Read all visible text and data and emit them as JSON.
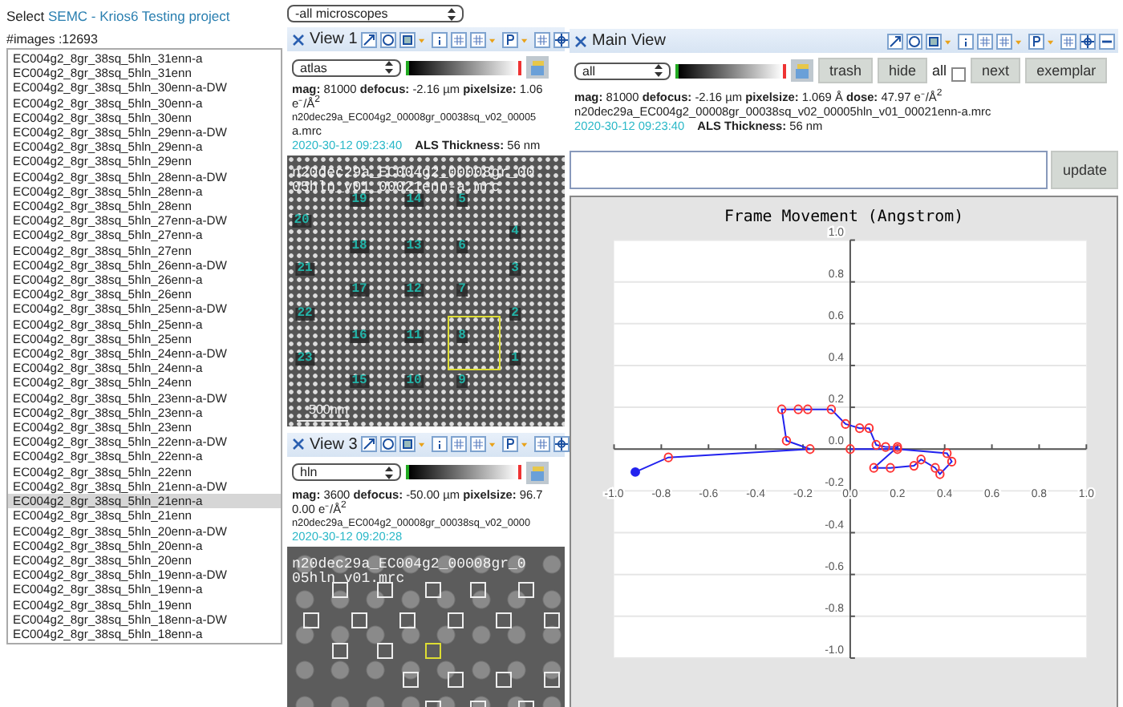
{
  "project": {
    "prefix": "Select",
    "link": "SEMC - Krios6 Testing project"
  },
  "image_count": "#images :12693",
  "image_list": [
    {
      "name": "EC004g2_8gr_38sq_5hln_31enn-a",
      "selected": false
    },
    {
      "name": "EC004g2_8gr_38sq_5hln_31enn",
      "selected": false
    },
    {
      "name": "EC004g2_8gr_38sq_5hln_30enn-a-DW",
      "selected": false
    },
    {
      "name": "EC004g2_8gr_38sq_5hln_30enn-a",
      "selected": false
    },
    {
      "name": "EC004g2_8gr_38sq_5hln_30enn",
      "selected": false
    },
    {
      "name": "EC004g2_8gr_38sq_5hln_29enn-a-DW",
      "selected": false
    },
    {
      "name": "EC004g2_8gr_38sq_5hln_29enn-a",
      "selected": false
    },
    {
      "name": "EC004g2_8gr_38sq_5hln_29enn",
      "selected": false
    },
    {
      "name": "EC004g2_8gr_38sq_5hln_28enn-a-DW",
      "selected": false
    },
    {
      "name": "EC004g2_8gr_38sq_5hln_28enn-a",
      "selected": false
    },
    {
      "name": "EC004g2_8gr_38sq_5hln_28enn",
      "selected": false
    },
    {
      "name": "EC004g2_8gr_38sq_5hln_27enn-a-DW",
      "selected": false
    },
    {
      "name": "EC004g2_8gr_38sq_5hln_27enn-a",
      "selected": false
    },
    {
      "name": "EC004g2_8gr_38sq_5hln_27enn",
      "selected": false
    },
    {
      "name": "EC004g2_8gr_38sq_5hln_26enn-a-DW",
      "selected": false
    },
    {
      "name": "EC004g2_8gr_38sq_5hln_26enn-a",
      "selected": false
    },
    {
      "name": "EC004g2_8gr_38sq_5hln_26enn",
      "selected": false
    },
    {
      "name": "EC004g2_8gr_38sq_5hln_25enn-a-DW",
      "selected": false
    },
    {
      "name": "EC004g2_8gr_38sq_5hln_25enn-a",
      "selected": false
    },
    {
      "name": "EC004g2_8gr_38sq_5hln_25enn",
      "selected": false
    },
    {
      "name": "EC004g2_8gr_38sq_5hln_24enn-a-DW",
      "selected": false
    },
    {
      "name": "EC004g2_8gr_38sq_5hln_24enn-a",
      "selected": false
    },
    {
      "name": "EC004g2_8gr_38sq_5hln_24enn",
      "selected": false
    },
    {
      "name": "EC004g2_8gr_38sq_5hln_23enn-a-DW",
      "selected": false
    },
    {
      "name": "EC004g2_8gr_38sq_5hln_23enn-a",
      "selected": false
    },
    {
      "name": "EC004g2_8gr_38sq_5hln_23enn",
      "selected": false
    },
    {
      "name": "EC004g2_8gr_38sq_5hln_22enn-a-DW",
      "selected": false
    },
    {
      "name": "EC004g2_8gr_38sq_5hln_22enn-a",
      "selected": false
    },
    {
      "name": "EC004g2_8gr_38sq_5hln_22enn",
      "selected": false
    },
    {
      "name": "EC004g2_8gr_38sq_5hln_21enn-a-DW",
      "selected": false
    },
    {
      "name": "EC004g2_8gr_38sq_5hln_21enn-a",
      "selected": true
    },
    {
      "name": "EC004g2_8gr_38sq_5hln_21enn",
      "selected": false
    },
    {
      "name": "EC004g2_8gr_38sq_5hln_20enn-a-DW",
      "selected": false
    },
    {
      "name": "EC004g2_8gr_38sq_5hln_20enn-a",
      "selected": false
    },
    {
      "name": "EC004g2_8gr_38sq_5hln_20enn",
      "selected": false
    },
    {
      "name": "EC004g2_8gr_38sq_5hln_19enn-a-DW",
      "selected": false
    },
    {
      "name": "EC004g2_8gr_38sq_5hln_19enn-a",
      "selected": false
    },
    {
      "name": "EC004g2_8gr_38sq_5hln_19enn",
      "selected": false
    },
    {
      "name": "EC004g2_8gr_38sq_5hln_18enn-a-DW",
      "selected": false
    },
    {
      "name": "EC004g2_8gr_38sq_5hln_18enn-a",
      "selected": false
    }
  ],
  "microscope_filter": {
    "value": "-all microscopes"
  },
  "views": [
    {
      "title": "View 1",
      "preset": "atlas",
      "info": "**mag:** 81000 **defocus:** -2.16 µm **pixelsize:** 1.06",
      "info_2": "e⁻/Å$^{2}$",
      "file": "n20dec29a_EC004g2_00008gr_00038sq_v02_00005",
      "file_2": "a.mrc",
      "timestamp": "2020-30-12 09:23:40",
      "thickness_label": "ALS Thickness:",
      "thickness": "56 nm",
      "image": {
        "kind": "atlas",
        "caption": [
          "n20dec29a_EC004g2_00008gr_00",
          "05hln_v01_00021enn-a.mrc"
        ],
        "targets": [
          "19",
          "14",
          "5",
          "20",
          "4",
          "18",
          "13",
          "6",
          "21",
          "3",
          "17",
          "12",
          "7",
          "22",
          "2",
          "16",
          "11",
          "8",
          "23",
          "1",
          "15",
          "10",
          "9"
        ],
        "scale_bar": "500nm"
      }
    },
    {
      "title": "View 3",
      "preset": "hln",
      "info": "**mag:** 3600 **defocus:** -50.00 µm **pixelsize:** 96.7",
      "info_2": "0.00 e⁻/Å$^{2}$",
      "file": "n20dec29a_EC004g2_00008gr_00038sq_v02_0000",
      "timestamp": "2020-30-12 09:20:28",
      "image": {
        "kind": "holes",
        "caption": [
          "n20dec29a_EC004g2_00008gr_0",
          "05hln_v01.mrc"
        ]
      }
    }
  ],
  "main_view": {
    "title": "Main View",
    "preset": "all",
    "actions": [
      "trash",
      "hide"
    ],
    "all_toggle": {
      "label": "all",
      "checked": false
    },
    "nav": [
      "next",
      "exemplar"
    ],
    "info": "**mag:** 81000 **defocus:** -2.16 µm **pixelsize:** 1.069 Å **dose:** 47.97 e⁻/Å$^{2}$",
    "file": "n20dec29a_EC004g2_00008gr_00038sq_v02_00005hln_v01_00021enn-a.mrc",
    "timestamp": "2020-30-12 09:23:40",
    "thickness_label": "ALS Thickness:",
    "thickness": "56 nm",
    "update": "update",
    "chart_data": {
      "type": "line",
      "grid": true,
      "title": "Frame Movement (Angstrom)",
      "xlim": [
        -1,
        1
      ],
      "ylim": [
        -1,
        1
      ],
      "xticks": [
        {
          "value": -1,
          "label": "-1.0"
        },
        {
          "value": -0.8,
          "label": "-0.8"
        },
        {
          "value": -0.6,
          "label": "-0.6"
        },
        {
          "value": -0.4,
          "label": "-0.4"
        },
        {
          "value": -0.2,
          "label": "-0.2"
        },
        {
          "value": 0,
          "label": "0.0"
        },
        {
          "value": 0.2,
          "label": "0.2"
        },
        {
          "value": 0.4,
          "label": "0.4"
        },
        {
          "value": 0.6,
          "label": "0.6"
        },
        {
          "value": 0.8,
          "label": "0.8"
        },
        {
          "value": 1,
          "label": "1.0"
        }
      ],
      "yticks": [
        {
          "value": 1,
          "label": "1.0"
        },
        {
          "value": 0.8,
          "label": "0.8"
        },
        {
          "value": 0.6,
          "label": "0.6"
        },
        {
          "value": 0.4,
          "label": "0.4"
        },
        {
          "value": 0.2,
          "label": "0.2"
        },
        {
          "value": 0,
          "label": "0.0"
        },
        {
          "value": -0.2,
          "label": "-0.2"
        },
        {
          "value": -0.4,
          "label": "-0.4"
        },
        {
          "value": -0.6,
          "label": "-0.6"
        },
        {
          "value": -0.8,
          "label": "-0.8"
        },
        {
          "value": -1,
          "label": "-1.0"
        }
      ],
      "x": [
        -0.91,
        -0.77,
        -0.17,
        -0.27,
        -0.29,
        -0.22,
        -0.18,
        -0.08,
        -0.02,
        0.04,
        0.08,
        0.11,
        0.15,
        0.2,
        0.1,
        0.17,
        0.27,
        0.3,
        0.36,
        0.38,
        0.43,
        0.41,
        0.2,
        0.0
      ],
      "series": [
        {
          "color": "#2222ee",
          "marker": "circle",
          "values": [
            -0.11,
            -0.04,
            0.0,
            0.04,
            0.19,
            0.19,
            0.19,
            0.19,
            0.12,
            0.1,
            0.1,
            0.02,
            0.01,
            0.01,
            -0.09,
            -0.09,
            -0.08,
            -0.05,
            -0.09,
            -0.12,
            -0.06,
            -0.02,
            0.0,
            0.0
          ]
        }
      ]
    }
  }
}
